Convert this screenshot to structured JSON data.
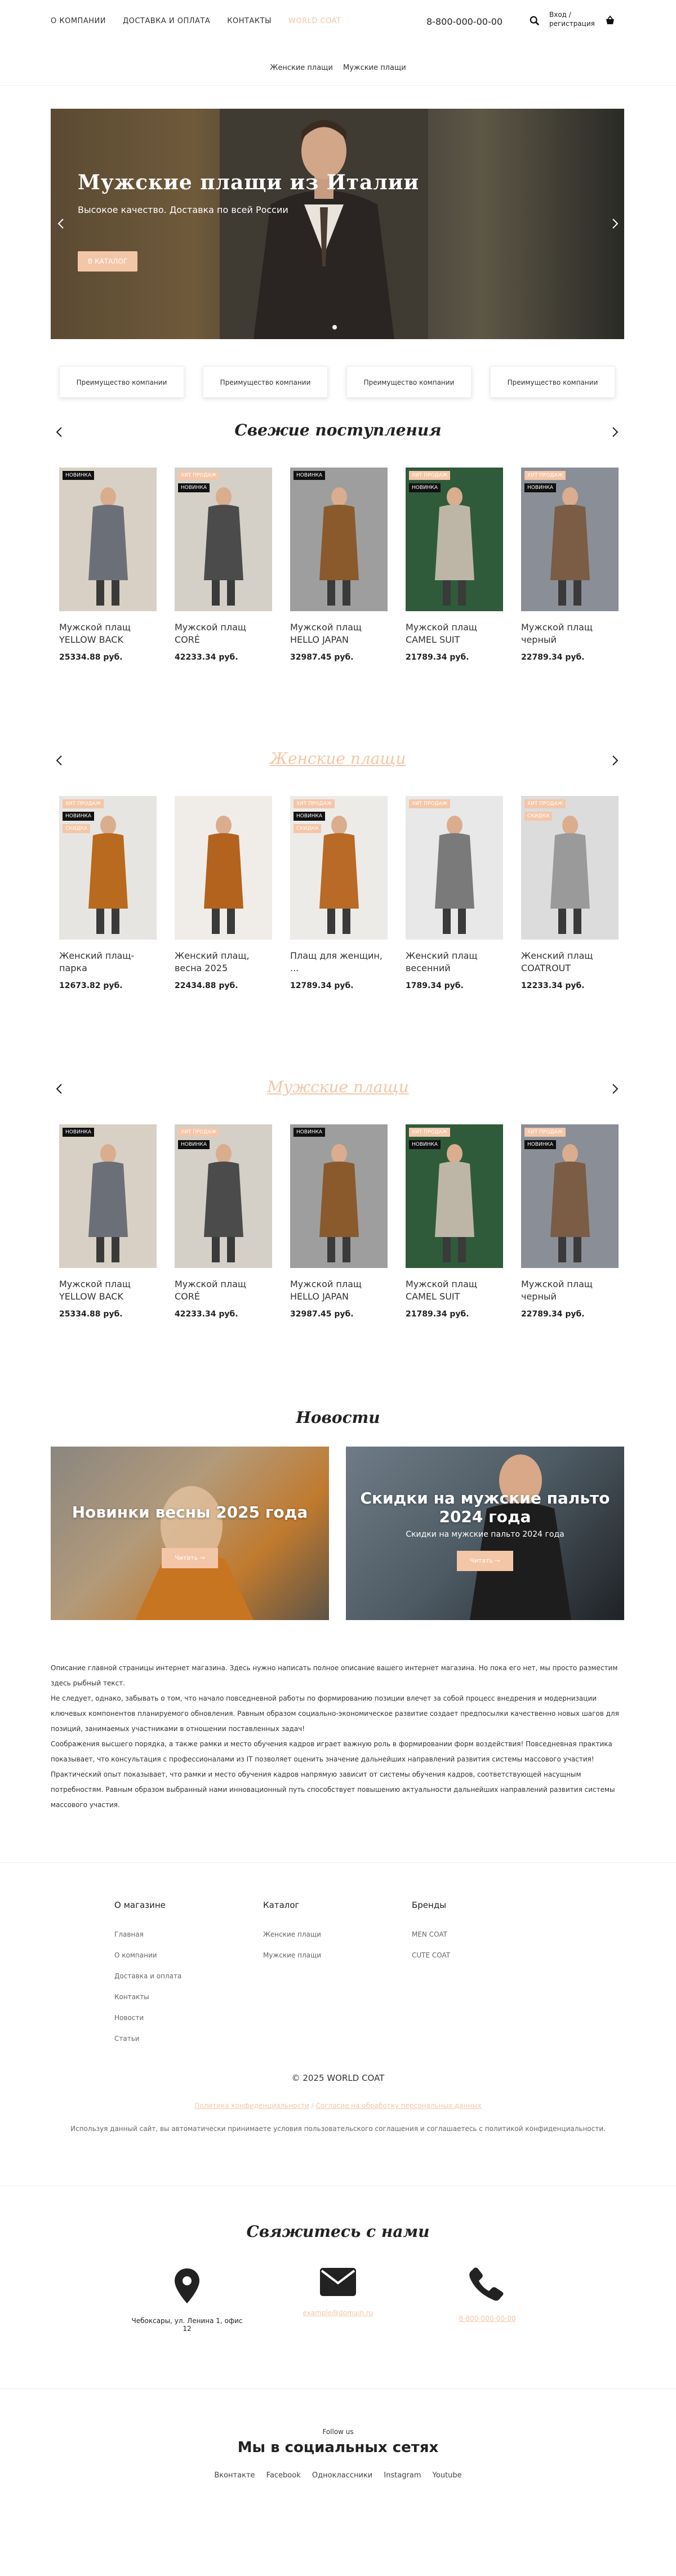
{
  "header": {
    "nav": [
      "О КОМПАНИИ",
      "ДОСТАВКА И ОПЛАТА",
      "КОНТАКТЫ",
      "WORLD COAT"
    ],
    "phone": "8-800-000-00-00",
    "login": "Вход / регистрация",
    "subnav": [
      "Женские плащи",
      "Мужские плащи"
    ]
  },
  "hero": {
    "title": "Мужские плащи из Италии",
    "subtitle": "Высокое качество. Доставка по всей России",
    "button": "В КАТАЛОГ"
  },
  "benefits": [
    "Преимущество компании",
    "Преимущество компании",
    "Преимущество компании",
    "Преимущество компании"
  ],
  "sections": [
    {
      "title": "Свежие поступления",
      "products": [
        {
          "name": "Мужской плащ YELLOW BACK",
          "price": "25334.88 руб.",
          "badges": [
            "НОВИНКА"
          ]
        },
        {
          "name": "Мужской плащ CORÉ",
          "price": "42233.34 руб.",
          "badges": [
            "ХИТ ПРОДАЖ",
            "НОВИНКА"
          ]
        },
        {
          "name": "Мужской плащ HELLO JAPAN",
          "price": "32987.45 руб.",
          "badges": [
            "НОВИНКА"
          ]
        },
        {
          "name": "Мужской плащ CAMEL SUIT",
          "price": "21789.34 руб.",
          "badges": [
            "ХИТ ПРОДАЖ",
            "НОВИНКА"
          ]
        },
        {
          "name": "Мужской плащ черный",
          "price": "22789.34 руб.",
          "badges": [
            "ХИТ ПРОДАЖ",
            "НОВИНКА"
          ]
        }
      ]
    },
    {
      "title": "Женские плащи",
      "products": [
        {
          "name": "Женский плащ-парка",
          "price": "12673.82 руб.",
          "badges": [
            "ХИТ ПРОДАЖ",
            "НОВИНКА",
            "СКИДКА"
          ]
        },
        {
          "name": "Женский плащ, весна 2025",
          "price": "22434.88 руб.",
          "badges": []
        },
        {
          "name": "Плащ для женщин, ...",
          "price": "12789.34 руб.",
          "badges": [
            "ХИТ ПРОДАЖ",
            "НОВИНКА",
            "СКИДКА"
          ]
        },
        {
          "name": "Женский плащ весенний",
          "price": "1789.34 руб.",
          "badges": [
            "ХИТ ПРОДАЖ"
          ]
        },
        {
          "name": "Женский плащ COATROUT",
          "price": "12233.34 руб.",
          "badges": [
            "ХИТ ПРОДАЖ",
            "СКИДКА"
          ]
        }
      ]
    },
    {
      "title": "Мужские плащи",
      "products": [
        {
          "name": "Мужской плащ YELLOW BACK",
          "price": "25334.88 руб.",
          "badges": [
            "НОВИНКА"
          ]
        },
        {
          "name": "Мужской плащ CORÉ",
          "price": "42233.34 руб.",
          "badges": [
            "ХИТ ПРОДАЖ",
            "НОВИНКА"
          ]
        },
        {
          "name": "Мужской плащ HELLO JAPAN",
          "price": "32987.45 руб.",
          "badges": [
            "НОВИНКА"
          ]
        },
        {
          "name": "Мужской плащ CAMEL SUIT",
          "price": "21789.34 руб.",
          "badges": [
            "ХИТ ПРОДАЖ",
            "НОВИНКА"
          ]
        },
        {
          "name": "Мужской плащ черный",
          "price": "22789.34 руб.",
          "badges": [
            "ХИТ ПРОДАЖ",
            "НОВИНКА"
          ]
        }
      ]
    }
  ],
  "news": {
    "title": "Новости",
    "items": [
      {
        "title": "Новинки весны 2025 года",
        "desc": "",
        "button": "Читать →"
      },
      {
        "title": "Скидки на мужские пальто 2024 года",
        "desc": "Скидки на мужские пальто 2024 года",
        "button": "Читать →"
      }
    ]
  },
  "description": [
    "Описание главной страницы интернет магазина. Здесь нужно написать полное описание вашего интернет магазина. Но пока его нет, мы просто разместим здесь рыбный текст.",
    "Не следует, однако, забывать о том, что начало повседневной работы по формированию позиции влечет за собой процесс внедрения и модернизации ключевых компонентов планируемого обновления. Равным образом социально-экономическое развитие создает предпосылки качественно новых шагов для позиций, занимаемых участниками в отношении поставленных задач!",
    "Соображения высшего порядка, а также рамки и место обучения кадров играет важную роль в формировании форм воздействия! Повседневная практика показывает, что консультация с профессионалами из IT позволяет оценить значение дальнейших направлений развития системы массового участия! Практический опыт показывает, что рамки и место обучения кадров напрямую зависит от системы обучения кадров, соответствующей насущным потребностям. Равным образом выбранный нами инновационный путь способствует повышению актуальности дальнейших направлений развития системы массового участия."
  ],
  "footer": {
    "columns": [
      {
        "title": "О магазине",
        "items": [
          "Главная",
          "О компании",
          "Доставка и оплата",
          "Контакты",
          "Новости",
          "Статьи"
        ]
      },
      {
        "title": "Каталог",
        "items": [
          "Женские плащи",
          "Мужские плащи"
        ]
      },
      {
        "title": "Бренды",
        "items": [
          "MEN COAT",
          "CUTE COAT"
        ]
      }
    ],
    "copyright": "© 2025 WORLD COAT",
    "privacy": "Политика конфиденциальности",
    "separator": "/",
    "consent": "Согласие на обработку персональных данных",
    "cookie": "Используя данный сайт, вы автоматически принимаете условия пользовательского соглашения и соглашаетесь с политикой конфиденциальности."
  },
  "contacts": {
    "title": "Свяжитесь с нами",
    "address": "Чебоксары, ул. Ленина 1, офис 12",
    "email": "example@domain.ru",
    "phone": "8-800-000-00-00"
  },
  "social": {
    "follow": "Follow us",
    "title": "Мы в социальных сетях",
    "links": [
      "Вконтакте",
      "Facebook",
      "Одноклассники",
      "Instagram",
      "Youtube"
    ]
  },
  "colors": {
    "accent": "#f4c6a8",
    "badge_new": "#111111"
  }
}
